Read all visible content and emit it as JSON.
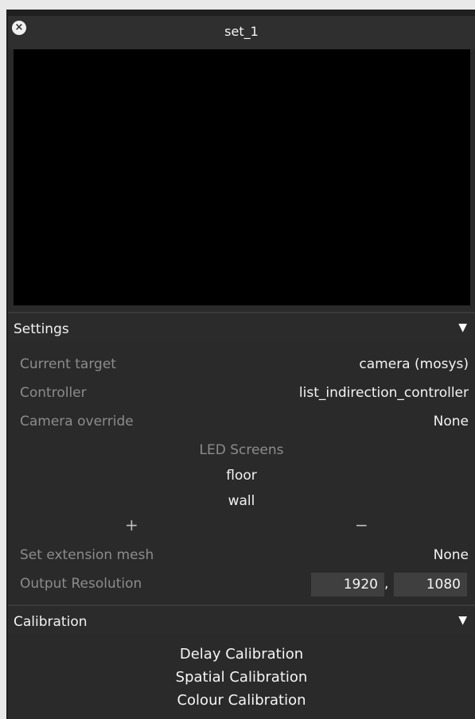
{
  "window": {
    "title": "set_1",
    "close_icon": "×"
  },
  "settings": {
    "header": "Settings",
    "caret": "▼",
    "rows": {
      "current_target": {
        "label": "Current target",
        "value": "camera (mosys)"
      },
      "controller": {
        "label": "Controller",
        "value": "list_indirection_controller"
      },
      "camera_override": {
        "label": "Camera override",
        "value": "None"
      }
    },
    "led_screens": {
      "label": "LED Screens",
      "items": [
        "floor",
        "wall"
      ],
      "add": "+",
      "remove": "−"
    },
    "extension_mesh": {
      "label": "Set extension mesh",
      "value": "None"
    },
    "output_resolution": {
      "label": "Output Resolution",
      "width": "1920",
      "separator": ",",
      "height": "1080"
    }
  },
  "calibration": {
    "header": "Calibration",
    "caret": "▼",
    "items": [
      "Delay Calibration",
      "Spatial Calibration",
      "Colour Calibration"
    ]
  },
  "colors": {
    "panel_bg": "#2a2a2a",
    "viewport_bg": "#000000",
    "label_grey": "#8c8c8c",
    "field_bg": "#3f3f3f"
  }
}
